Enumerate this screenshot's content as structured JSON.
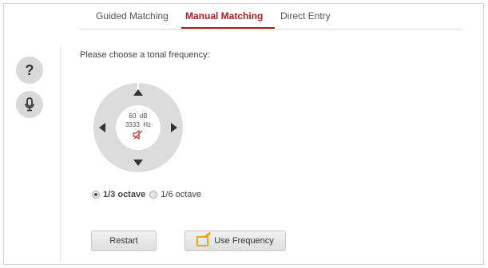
{
  "tabs": [
    {
      "label": "Guided Matching",
      "active": false
    },
    {
      "label": "Manual Matching",
      "active": true
    },
    {
      "label": "Direct Entry",
      "active": false
    }
  ],
  "side": {
    "help_label": "?",
    "mic_icon": "microphone-icon"
  },
  "prompt": "Please choose a tonal frequency:",
  "wheel": {
    "level_value": "60",
    "level_unit": "dB",
    "freq_value": "3333",
    "freq_unit": "Hz",
    "mute_icon": "speaker-muted-icon"
  },
  "octave_options": [
    {
      "label": "1/3 octave",
      "selected": true
    },
    {
      "label": "1/6 octave",
      "selected": false
    }
  ],
  "buttons": {
    "restart": "Restart",
    "use_frequency": "Use Frequency"
  },
  "colors": {
    "accent": "#b01c24",
    "icon_orange": "#f0a21a"
  }
}
